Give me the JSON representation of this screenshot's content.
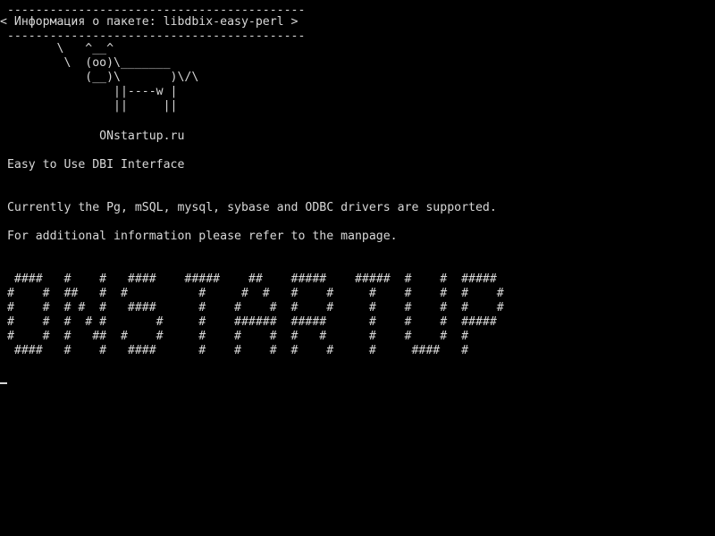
{
  "terminal": {
    "bubble": {
      "top_border": " ------------------------------------------",
      "message": "< Информация о пакете: libdbix-easy-perl >",
      "bottom_border": " ------------------------------------------"
    },
    "cow": [
      "        \\   ^__^",
      "         \\  (oo)\\_______",
      "            (__)\\       )\\/\\",
      "                ||----w |",
      "                ||     ||"
    ],
    "signature": "              ONstartup.ru",
    "summary": " Easy to Use DBI Interface",
    "description": [
      " Currently the Pg, mSQL, mysql, sybase and ODBC drivers are supported.",
      " For additional information please refer to the manpage."
    ],
    "banner": [
      "  ####   #    #   ####    #####    ##    #####    #####  #    #  #####",
      " #    #  ##   #  #          #     #  #   #    #     #    #    #  #    #",
      " #    #  # #  #   ####      #    #    #  #    #     #    #    #  #    #",
      " #    #  #  # #       #     #    ######  #####      #    #    #  #####",
      " #    #  #   ##  #    #     #    #    #  #   #      #    #    #  #",
      "  ####   #    #   ####      #    #    #  #    #     #     ####   #"
    ]
  }
}
